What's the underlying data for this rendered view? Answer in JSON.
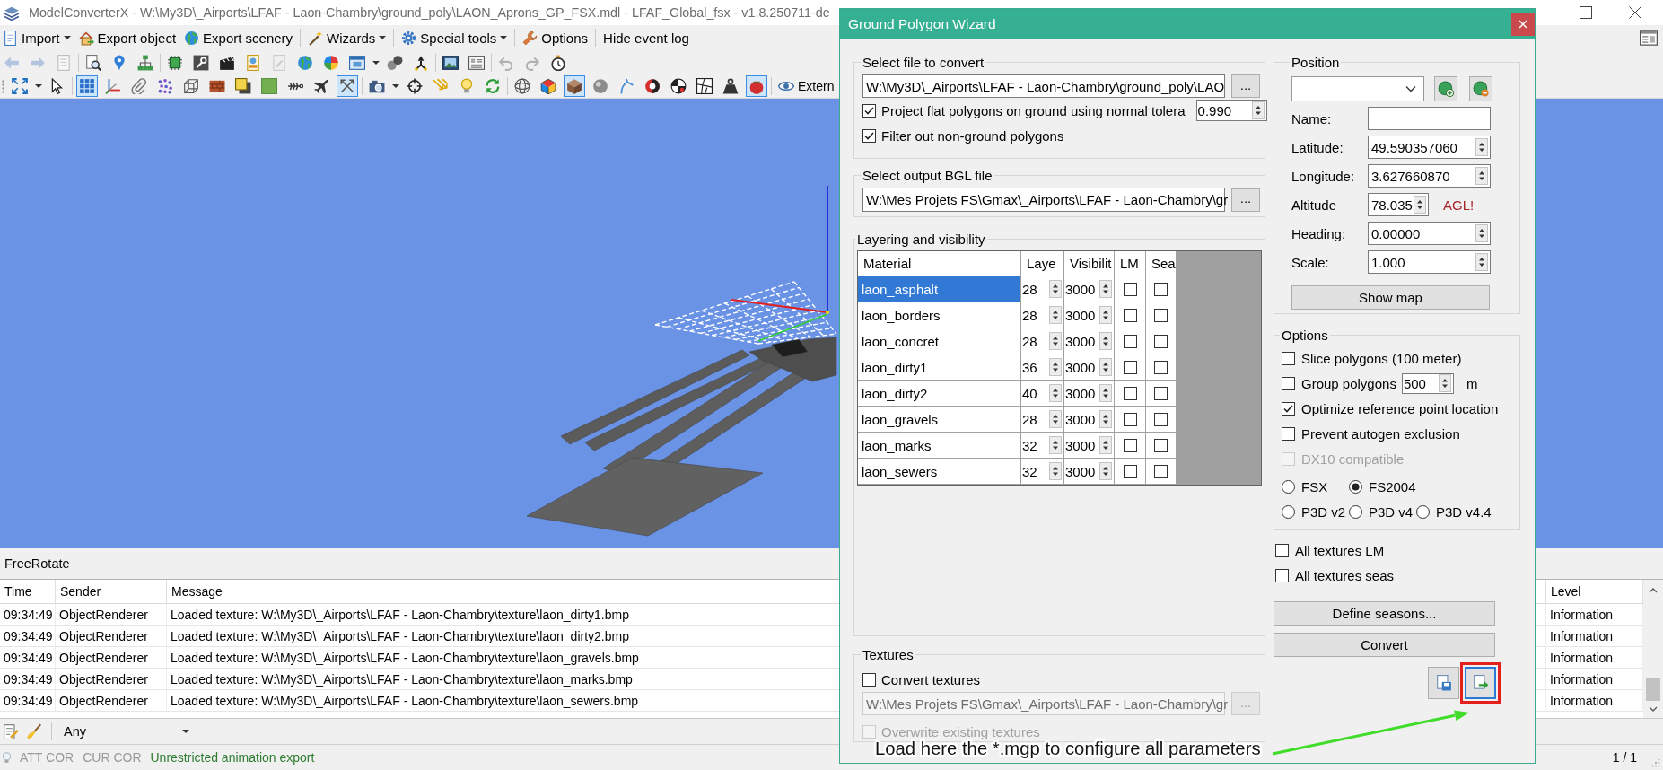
{
  "window": {
    "title": "ModelConverterX - W:\\My3D\\_Airports\\LFAF - Laon-Chambry\\ground_poly\\LAON_Aprons_GP_FSX.mdl - LFAF_Global_fsx - v1.8.250711-de"
  },
  "menu": [
    {
      "label": "Import",
      "dropdown": true
    },
    {
      "label": "Export object",
      "dropdown": false
    },
    {
      "label": "Export scenery",
      "dropdown": false
    },
    {
      "label": "Wizards",
      "dropdown": true
    },
    {
      "label": "Special tools",
      "dropdown": true
    },
    {
      "label": "Options",
      "dropdown": false
    },
    {
      "label": "Hide event log",
      "dropdown": false
    }
  ],
  "toolbar_1": [
    {
      "disabled": true
    },
    {
      "disabled": true
    },
    {
      "disabled": true
    },
    {
      "disabled": false
    },
    {
      "disabled": false
    },
    {
      "disabled": false
    },
    {
      "disabled": false
    },
    {
      "disabled": false
    },
    {
      "disabled": false
    },
    {
      "disabled": false
    },
    {
      "disabled": true
    },
    {
      "disabled": false
    },
    {
      "disabled": false
    },
    {
      "disabled": false
    },
    {
      "disabled": false
    },
    {
      "disabled": false
    },
    {
      "disabled": false
    },
    {
      "disabled": false
    },
    {
      "disabled": true
    },
    {
      "disabled": true
    },
    {
      "disabled": false
    }
  ],
  "toolbar_2": [
    {
      "selected": false
    },
    {
      "selected": false
    },
    {
      "selected": true
    },
    {
      "selected": false
    },
    {
      "selected": false
    },
    {
      "selected": false
    },
    {
      "selected": false
    },
    {
      "selected": false
    },
    {
      "selected": false
    },
    {
      "selected": false
    },
    {
      "selected": false
    },
    {
      "selected": false
    },
    {
      "selected": true
    },
    {
      "selected": false
    },
    {
      "selected": false
    },
    {
      "selected": false
    },
    {
      "selected": false
    },
    {
      "selected": false
    },
    {
      "selected": false
    },
    {
      "selected": false
    },
    {
      "selected": true
    },
    {
      "selected": false
    },
    {
      "selected": false
    },
    {
      "selected": false
    },
    {
      "selected": false
    },
    {
      "selected": false
    },
    {
      "selected": false
    },
    {
      "selected": true
    },
    {
      "selected": false,
      "label": "Extern"
    }
  ],
  "viewport": {
    "mode": "FreeRotate"
  },
  "event_log": {
    "columns": [
      "Time",
      "Sender",
      "Message",
      "Level"
    ],
    "rows": [
      {
        "time": "09:34:49",
        "sender": "ObjectRenderer",
        "message": "Loaded texture: W:\\My3D\\_Airports\\LFAF - Laon-Chambry\\texture\\laon_dirty1.bmp",
        "level": "Information"
      },
      {
        "time": "09:34:49",
        "sender": "ObjectRenderer",
        "message": "Loaded texture: W:\\My3D\\_Airports\\LFAF - Laon-Chambry\\texture\\laon_dirty2.bmp",
        "level": "Information"
      },
      {
        "time": "09:34:49",
        "sender": "ObjectRenderer",
        "message": "Loaded texture: W:\\My3D\\_Airports\\LFAF - Laon-Chambry\\texture\\laon_gravels.bmp",
        "level": "Information"
      },
      {
        "time": "09:34:49",
        "sender": "ObjectRenderer",
        "message": "Loaded texture: W:\\My3D\\_Airports\\LFAF - Laon-Chambry\\texture\\laon_marks.bmp",
        "level": "Information"
      },
      {
        "time": "09:34:49",
        "sender": "ObjectRenderer",
        "message": "Loaded texture: W:\\My3D\\_Airports\\LFAF - Laon-Chambry\\texture\\laon_sewers.bmp",
        "level": "Information"
      }
    ],
    "filter": "Any"
  },
  "status_bar": {
    "items": [
      {
        "text": "ATT COR",
        "color": "#9a9a9a"
      },
      {
        "text": "CUR COR",
        "color": "#9a9a9a"
      },
      {
        "text": "Unrestricted animation export",
        "color": "#2e7d32"
      }
    ],
    "page": "1 / 1"
  },
  "dialog": {
    "title": "Ground Polygon Wizard",
    "source": {
      "legend": "Select file to convert",
      "path": "W:\\My3D\\_Airports\\LFAF - Laon-Chambry\\ground_poly\\LAO",
      "browse": "...",
      "options": [
        {
          "label": "Project flat polygons on ground using normal tolera",
          "checked": true,
          "value": "0.990"
        },
        {
          "label": "Filter out non-ground polygons",
          "checked": true
        }
      ]
    },
    "output": {
      "legend": "Select output BGL file",
      "path": "W:\\Mes Projets FS\\Gmax\\_Airports\\LFAF - Laon-Chambry\\gr",
      "browse": "..."
    },
    "layering": {
      "legend": "Layering and visibility",
      "columns": [
        "Material",
        "Laye",
        "Visibilit",
        "LM",
        "Sea"
      ],
      "rows": [
        {
          "material": "laon_asphalt",
          "layer": "28",
          "visibility": "3000",
          "lm": false,
          "seas": false,
          "selected": true
        },
        {
          "material": "laon_borders",
          "layer": "28",
          "visibility": "3000",
          "lm": false,
          "seas": false,
          "selected": false
        },
        {
          "material": "laon_concret",
          "layer": "28",
          "visibility": "3000",
          "lm": false,
          "seas": false,
          "selected": false
        },
        {
          "material": "laon_dirty1",
          "layer": "36",
          "visibility": "3000",
          "lm": false,
          "seas": false,
          "selected": false
        },
        {
          "material": "laon_dirty2",
          "layer": "40",
          "visibility": "3000",
          "lm": false,
          "seas": false,
          "selected": false
        },
        {
          "material": "laon_gravels",
          "layer": "28",
          "visibility": "3000",
          "lm": false,
          "seas": false,
          "selected": false
        },
        {
          "material": "laon_marks",
          "layer": "32",
          "visibility": "3000",
          "lm": false,
          "seas": false,
          "selected": false
        },
        {
          "material": "laon_sewers",
          "layer": "32",
          "visibility": "3000",
          "lm": false,
          "seas": false,
          "selected": false
        }
      ]
    },
    "textures": {
      "legend": "Textures",
      "convert": {
        "label": "Convert textures",
        "checked": false
      },
      "path": {
        "value": "W:\\Mes Projets FS\\Gmax\\_Airports\\LFAF - Laon-Chambry\\gr",
        "disabled": true
      },
      "browse": {
        "label": "...",
        "disabled": true
      },
      "overwrite": {
        "label": "Overwrite existing textures",
        "checked": false,
        "disabled": true
      }
    },
    "position": {
      "legend": "Position",
      "fields": [
        {
          "label": "Name:",
          "kind": "text"
        },
        {
          "label": "Latitude:",
          "value": "49.590357060",
          "kind": "spin"
        },
        {
          "label": "Longitude:",
          "value": "3.627660870",
          "kind": "spin"
        },
        {
          "label": "Altitude",
          "value": "78.035",
          "kind": "spin",
          "note": "AGL!"
        },
        {
          "label": "Heading:",
          "value": "0.00000",
          "kind": "spin"
        },
        {
          "label": "Scale:",
          "value": "1.000",
          "kind": "spin"
        }
      ],
      "map_button": "Show map"
    },
    "options": {
      "legend": "Options",
      "checks": [
        {
          "label": "Slice polygons (100 meter)",
          "checked": false,
          "disabled": false
        },
        {
          "label": "Group polygons",
          "checked": false,
          "disabled": false,
          "value": "500",
          "unit": "m"
        },
        {
          "label": "Optimize reference point location",
          "checked": true,
          "disabled": false
        },
        {
          "label": "Prevent autogen exclusion",
          "checked": false,
          "disabled": false
        },
        {
          "label": "DX10 compatible",
          "checked": false,
          "disabled": true
        }
      ],
      "targets": [
        [
          {
            "label": "FSX",
            "selected": false
          },
          {
            "label": "FS2004",
            "selected": true
          }
        ],
        [
          {
            "label": "P3D v2",
            "selected": false
          },
          {
            "label": "P3D v4",
            "selected": false
          },
          {
            "label": "P3D v4.4",
            "selected": false
          }
        ]
      ]
    },
    "texture_flags": [
      {
        "label": "All textures LM",
        "checked": false
      },
      {
        "label": "All textures seas",
        "checked": false
      }
    ],
    "buttons": [
      "Define seasons...",
      "Convert"
    ],
    "icon_buttons": [
      {
        "focused": false,
        "highlighted": false
      },
      {
        "focused": true,
        "highlighted": true
      }
    ],
    "callout": "Load here the *.mgp to configure all parameters"
  }
}
